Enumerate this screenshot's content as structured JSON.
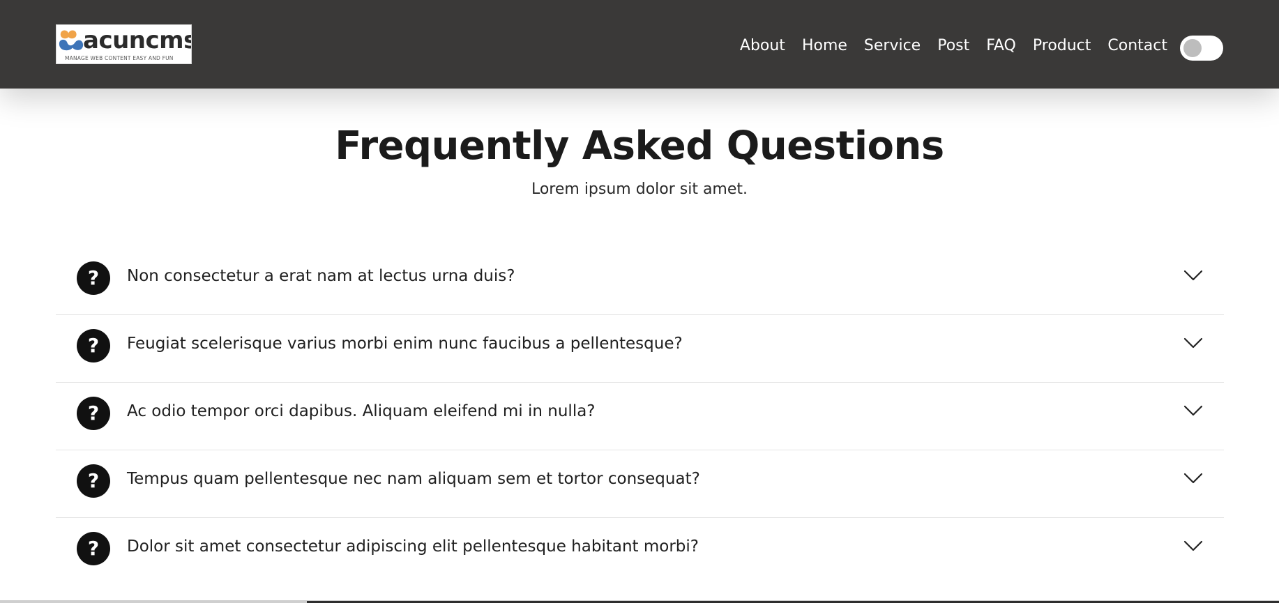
{
  "header": {
    "logo": {
      "name": "acuncms",
      "tagline": "MANAGE WEB CONTENT EASY AND FUN"
    },
    "nav": [
      {
        "label": "About"
      },
      {
        "label": "Home"
      },
      {
        "label": "Service"
      },
      {
        "label": "Post"
      },
      {
        "label": "FAQ"
      },
      {
        "label": "Product"
      },
      {
        "label": "Contact"
      }
    ],
    "theme_toggle": {
      "state": "off"
    }
  },
  "main": {
    "title": "Frequently Asked Questions",
    "subtitle": "Lorem ipsum dolor sit amet.",
    "faqs": [
      {
        "icon": "?",
        "question": "Non consectetur a erat nam at lectus urna duis?"
      },
      {
        "icon": "?",
        "question": "Feugiat scelerisque varius morbi enim nunc faucibus a pellentesque?"
      },
      {
        "icon": "?",
        "question": "Ac odio tempor orci dapibus. Aliquam eleifend mi in nulla?"
      },
      {
        "icon": "?",
        "question": "Tempus quam pellentesque nec nam aliquam sem et tortor consequat?"
      },
      {
        "icon": "?",
        "question": "Dolor sit amet consectetur adipiscing elit pellentesque habitant morbi?"
      }
    ]
  },
  "colors": {
    "header_bg": "#3a3938",
    "nav_text": "#ffffff",
    "icon_bg": "#111111",
    "text": "#1f1f1f",
    "divider": "#e4e4e4"
  }
}
